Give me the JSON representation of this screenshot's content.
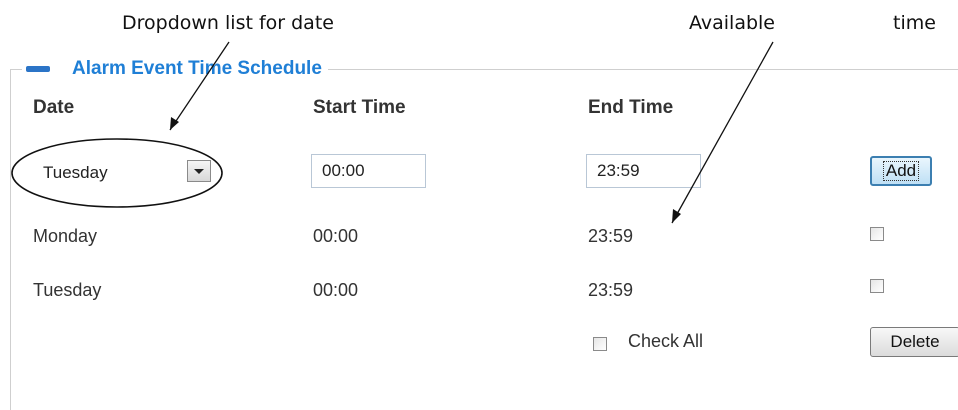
{
  "annotations": {
    "dropdown_note": "Dropdown list for date",
    "available_note": "Available",
    "time_note": "time"
  },
  "section": {
    "title": "Alarm Event Time Schedule",
    "accent_color": "#1f7fd6"
  },
  "headers": {
    "date": "Date",
    "start_time": "Start Time",
    "end_time": "End Time"
  },
  "form": {
    "date_selected": "Tuesday",
    "start_time": "00:00",
    "end_time": "23:59",
    "add_label": "Add"
  },
  "rows": [
    {
      "date": "Monday",
      "start": "00:00",
      "end": "23:59",
      "checked": false
    },
    {
      "date": "Tuesday",
      "start": "00:00",
      "end": "23:59",
      "checked": false
    }
  ],
  "footer": {
    "check_all_label": "Check All",
    "delete_label": "Delete"
  }
}
